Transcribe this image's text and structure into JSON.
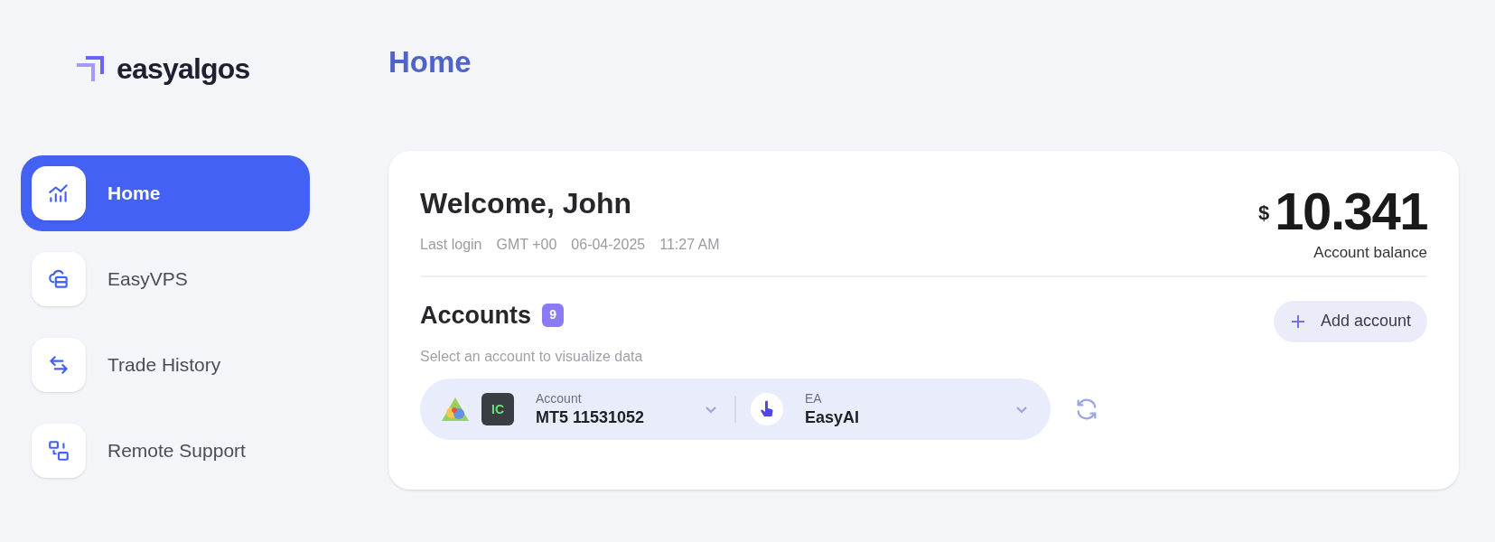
{
  "logo": {
    "text": "easyalgos"
  },
  "sidebar": {
    "items": [
      {
        "label": "Home",
        "kind": "chart",
        "selected": true
      },
      {
        "label": "EasyVPS",
        "kind": "cloud",
        "selected": false
      },
      {
        "label": "Trade History",
        "kind": "swap",
        "selected": false
      },
      {
        "label": "Remote Support",
        "kind": "remote",
        "selected": false
      }
    ]
  },
  "page_title": "Home",
  "welcome": {
    "title": "Welcome, John",
    "last_login": [
      "Last login",
      "GMT +00",
      "06-04-2025",
      "11:27 AM"
    ]
  },
  "balance": {
    "currency": "$",
    "amount": "10.341",
    "label": "Account balance"
  },
  "accounts": {
    "title": "Accounts",
    "count": "9",
    "subtitle": "Select an account to visualize data",
    "add_button": "Add account",
    "selectors": [
      {
        "kind": "account",
        "label": "Account",
        "value": "MT5 11531052",
        "badge": "IC"
      },
      {
        "kind": "ea",
        "label": "EA",
        "value": "EasyAI"
      }
    ]
  }
}
